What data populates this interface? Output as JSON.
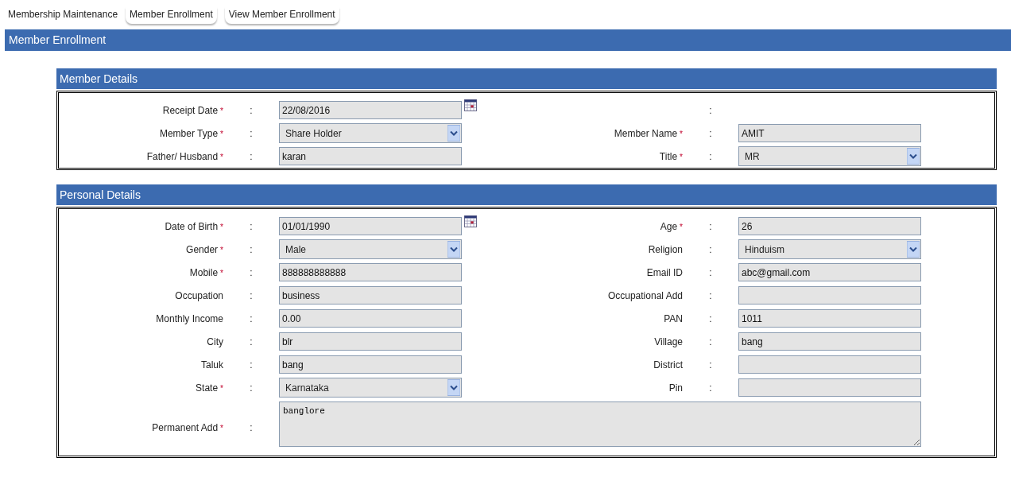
{
  "nav": [
    {
      "kind": "label",
      "label": "Membership Maintenance"
    },
    {
      "kind": "tab",
      "label": "Member Enrollment"
    },
    {
      "kind": "tab",
      "label": "View Member Enrollment"
    }
  ],
  "page_title": "Member Enrollment",
  "sections": [
    {
      "title": "Member Details",
      "rows": [
        {
          "left": {
            "label": "Receipt Date",
            "mark": "*",
            "colon": ":",
            "kind": "date",
            "value": "22/08/2016"
          },
          "right": {
            "colon": ":"
          }
        },
        {
          "left": {
            "label": "Member Type",
            "mark": "*",
            "colon": ":",
            "kind": "select",
            "value": "Share Holder"
          },
          "right": {
            "label": "Member Name",
            "mark": "*",
            "colon": ":",
            "kind": "text",
            "value": "AMIT"
          }
        },
        {
          "left": {
            "label": "Father/ Husband",
            "mark": "*",
            "colon": ":",
            "kind": "text",
            "value": "karan"
          },
          "right": {
            "label": "Title",
            "mark": "*",
            "colon": ":",
            "kind": "select",
            "value": "MR"
          }
        }
      ]
    },
    {
      "title": "Personal Details",
      "rows": [
        {
          "left": {
            "label": "Date of Birth",
            "mark": "*",
            "colon": ":",
            "kind": "date",
            "value": "01/01/1990"
          },
          "right": {
            "label": "Age",
            "mark": "*",
            "colon": ":",
            "kind": "text",
            "value": "26"
          }
        },
        {
          "left": {
            "label": "Gender",
            "mark": "*",
            "colon": ":",
            "kind": "select",
            "value": "Male"
          },
          "right": {
            "label": "Religion",
            "colon": ":",
            "kind": "select",
            "value": "Hinduism"
          }
        },
        {
          "left": {
            "label": "Mobile",
            "mark": "*",
            "colon": ":",
            "kind": "text",
            "value": "888888888888"
          },
          "right": {
            "label": "Email ID",
            "colon": ":",
            "kind": "text",
            "value": "abc@gmail.com"
          }
        },
        {
          "left": {
            "label": "Occupation",
            "colon": ":",
            "kind": "text",
            "value": "business"
          },
          "right": {
            "label": "Occupational Add",
            "colon": ":",
            "kind": "text"
          }
        },
        {
          "left": {
            "label": "Monthly Income",
            "colon": ":",
            "kind": "text",
            "value": "0.00"
          },
          "right": {
            "label": "PAN",
            "colon": ":",
            "kind": "text",
            "value": "1011"
          }
        },
        {
          "left": {
            "label": "City",
            "colon": ":",
            "kind": "text",
            "value": "blr"
          },
          "right": {
            "label": "Village",
            "colon": ":",
            "kind": "text",
            "value": "bang"
          }
        },
        {
          "left": {
            "label": "Taluk",
            "colon": ":",
            "kind": "text",
            "value": "bang"
          },
          "right": {
            "label": "District",
            "colon": ":",
            "kind": "text"
          }
        },
        {
          "left": {
            "label": "State",
            "mark": "*",
            "colon": ":",
            "kind": "select",
            "value": "Karnataka"
          },
          "right": {
            "label": "Pin",
            "colon": ":",
            "kind": "text"
          }
        },
        {
          "wide": {
            "label": "Permanent Add",
            "mark": "*",
            "colon": ":",
            "kind": "textarea",
            "value": "banglore"
          }
        }
      ]
    }
  ]
}
